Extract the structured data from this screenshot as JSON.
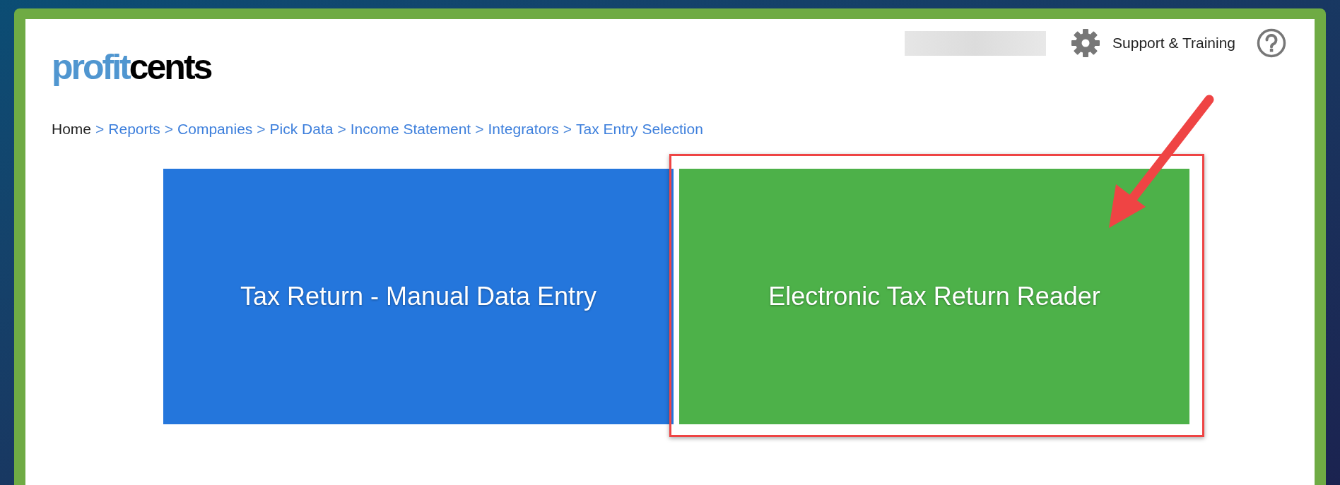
{
  "logo": {
    "part_1": "profit",
    "part_2": "cents"
  },
  "header": {
    "support_link": "Support & Training"
  },
  "breadcrumb": {
    "separator": ">",
    "items": [
      {
        "label": "Home",
        "kind": "text"
      },
      {
        "label": "Reports",
        "kind": "link"
      },
      {
        "label": "Companies",
        "kind": "link"
      },
      {
        "label": "Pick Data",
        "kind": "link"
      },
      {
        "label": "Income Statement",
        "kind": "link"
      },
      {
        "label": "Integrators",
        "kind": "link"
      },
      {
        "label": "Tax Entry Selection",
        "kind": "link"
      }
    ]
  },
  "tiles": [
    {
      "label": "Tax Return - Manual Data Entry",
      "color": "#2476dc",
      "highlighted": false
    },
    {
      "label": "Electronic Tax Return Reader",
      "color": "#4db149",
      "highlighted": true
    }
  ]
}
